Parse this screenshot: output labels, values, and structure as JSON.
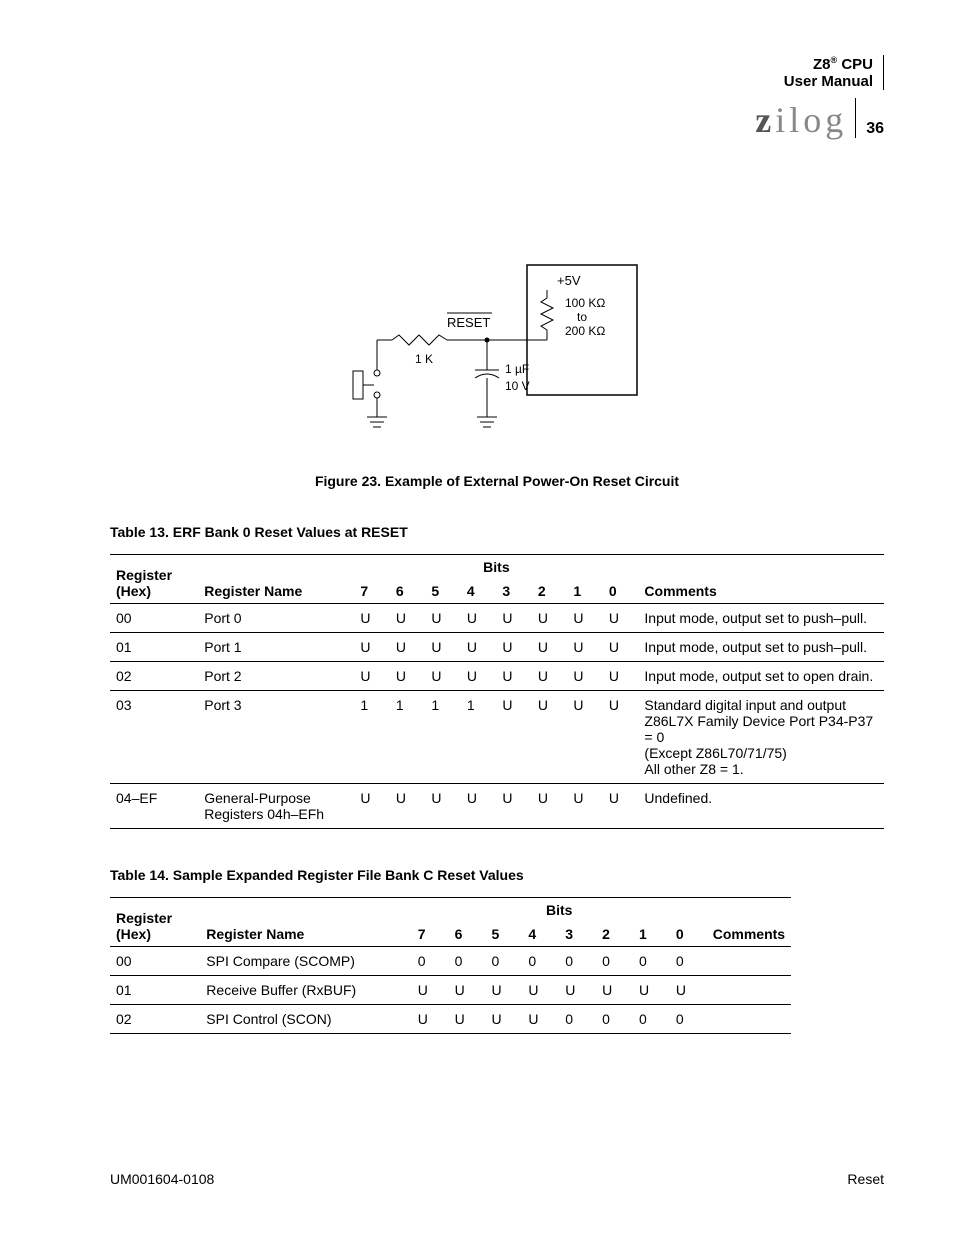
{
  "header": {
    "product": "Z8",
    "suffix": " CPU",
    "subtitle": "User Manual",
    "logo_text": "zilog",
    "page_number": "36"
  },
  "figure": {
    "caption": "Figure 23. Example of External Power-On Reset Circuit",
    "labels": {
      "vcc": "+5V",
      "rtop1": "100 KΩ",
      "rtop_to": "to",
      "rtop2": "200 KΩ",
      "signal": "RESET",
      "r1": "1 K",
      "cap1": "1 µF",
      "cap2": "10 V"
    }
  },
  "table13": {
    "caption": "Table 13. ERF Bank 0 Reset Values at RESET",
    "col_reg1": "Register",
    "col_reg2": "(Hex)",
    "col_name": "Register Name",
    "col_bits": "Bits",
    "bit_headers": [
      "7",
      "6",
      "5",
      "4",
      "3",
      "2",
      "1",
      "0"
    ],
    "col_comments": "Comments",
    "rows": [
      {
        "hex": "00",
        "name": "Port 0",
        "bits": [
          "U",
          "U",
          "U",
          "U",
          "U",
          "U",
          "U",
          "U"
        ],
        "comment": "Input mode, output set to push–pull."
      },
      {
        "hex": "01",
        "name": "Port 1",
        "bits": [
          "U",
          "U",
          "U",
          "U",
          "U",
          "U",
          "U",
          "U"
        ],
        "comment": "Input mode, output set to push–pull."
      },
      {
        "hex": "02",
        "name": "Port 2",
        "bits": [
          "U",
          "U",
          "U",
          "U",
          "U",
          "U",
          "U",
          "U"
        ],
        "comment": "Input mode, output set to open drain."
      },
      {
        "hex": "03",
        "name": "Port 3",
        "bits": [
          "1",
          "1",
          "1",
          "1",
          "U",
          "U",
          "U",
          "U"
        ],
        "comment": "Standard digital input and output Z86L7X Family Device Port P34-P37 = 0\n(Except Z86L70/71/75)\nAll other Z8 = 1."
      },
      {
        "hex": "04–EF",
        "name": "General-Purpose Registers 04h–EFh",
        "bits": [
          "U",
          "U",
          "U",
          "U",
          "U",
          "U",
          "U",
          "U"
        ],
        "comment": "Undefined."
      }
    ]
  },
  "table14": {
    "caption": "Table 14. Sample Expanded Register File Bank C Reset Values",
    "col_reg1": "Register",
    "col_reg2": "(Hex)",
    "col_name": "Register Name",
    "col_bits": "Bits",
    "bit_headers": [
      "7",
      "6",
      "5",
      "4",
      "3",
      "2",
      "1",
      "0"
    ],
    "col_comments": "Comments",
    "rows": [
      {
        "hex": "00",
        "name": "SPI Compare (SCOMP)",
        "bits": [
          "0",
          "0",
          "0",
          "0",
          "0",
          "0",
          "0",
          "0"
        ],
        "comment": ""
      },
      {
        "hex": "01",
        "name": "Receive Buffer (RxBUF)",
        "bits": [
          "U",
          "U",
          "U",
          "U",
          "U",
          "U",
          "U",
          "U"
        ],
        "comment": ""
      },
      {
        "hex": "02",
        "name": "SPI Control (SCON)",
        "bits": [
          "U",
          "U",
          "U",
          "U",
          "0",
          "0",
          "0",
          "0"
        ],
        "comment": ""
      }
    ]
  },
  "footer": {
    "left": "UM001604-0108",
    "right": "Reset"
  }
}
